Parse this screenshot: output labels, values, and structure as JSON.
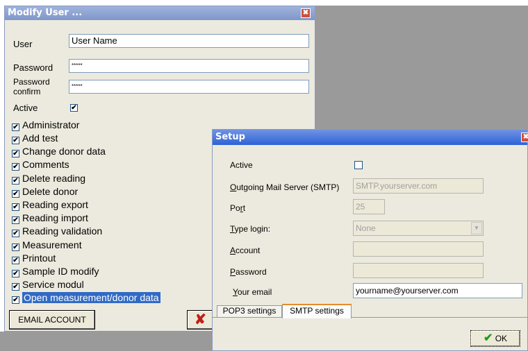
{
  "modify_user": {
    "title": "Modify User ...",
    "close": "✖",
    "user_label": "User",
    "user_value": "User Name",
    "password_label": "Password",
    "password_value": "*****",
    "password_confirm_label_1": "Password",
    "password_confirm_label_2": "confirm",
    "password_confirm_value": "*****",
    "active_label": "Active",
    "active_checked": "✔",
    "permissions": [
      {
        "label": "Administrator",
        "check": "✔"
      },
      {
        "label": "Add test",
        "check": "✔"
      },
      {
        "label": "Change donor data",
        "check": "✔"
      },
      {
        "label": "Comments",
        "check": "✔"
      },
      {
        "label": "Delete reading",
        "check": "✔"
      },
      {
        "label": "Delete donor",
        "check": "✔"
      },
      {
        "label": "Reading export",
        "check": "✔"
      },
      {
        "label": "Reading import",
        "check": "✔"
      },
      {
        "label": "Reading validation",
        "check": "✔"
      },
      {
        "label": "Measurement",
        "check": "✔"
      },
      {
        "label": "Printout",
        "check": "✔"
      },
      {
        "label": "Sample ID modify",
        "check": "✔"
      },
      {
        "label": "Service modul",
        "check": "✔"
      },
      {
        "label": "Open measurement/donor data",
        "check": "✔"
      }
    ],
    "email_account_button": "EMAIL ACCOUNT",
    "cancel_glyph": "✘"
  },
  "setup": {
    "title": "Setup",
    "close": "✖",
    "active_label": "Active",
    "smtp_label_u": "O",
    "smtp_label_rest": "utgoing Mail Server (SMTP)",
    "smtp_value": "SMTP.yourserver.com",
    "port_label_a": "Po",
    "port_label_u": "r",
    "port_label_b": "t",
    "port_value": "25",
    "type_label_u": "T",
    "type_label_rest": "ype login:",
    "type_value": "None",
    "dropdown_glyph": "▼",
    "account_label_u": "A",
    "account_label_rest": "ccount",
    "password_label_u": "P",
    "password_label_rest": "assword",
    "email_label_u": "Y",
    "email_label_rest": "our email",
    "email_value": "yourname@yourserver.com",
    "tabs": [
      "POP3 settings",
      "SMTP settings"
    ],
    "ok_label": "OK",
    "ok_glyph": "✔"
  },
  "colors": {
    "window_bg": "#eceade",
    "title_modify": "#8ea4d4",
    "title_setup": "#2d63d6",
    "selection": "#316ac5",
    "desktop_gray": "#9b9a9a"
  }
}
